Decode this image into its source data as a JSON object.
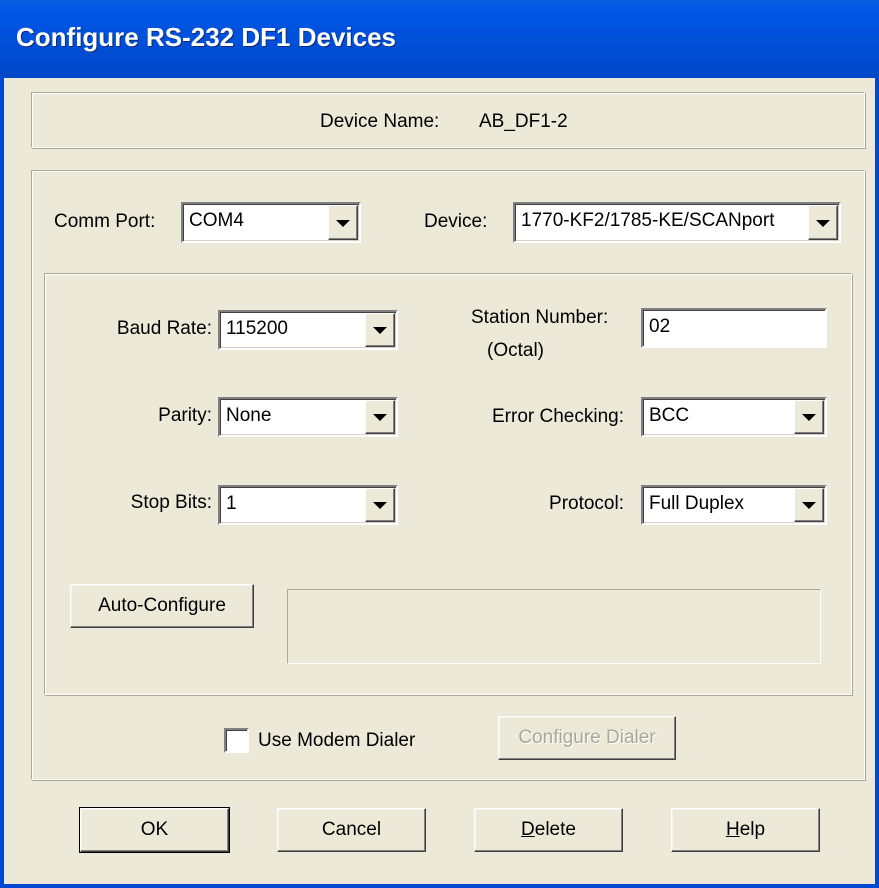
{
  "window": {
    "title": "Configure RS-232 DF1 Devices"
  },
  "device_name": {
    "label": "Device Name:",
    "value": "AB_DF1-2"
  },
  "comm_port": {
    "label": "Comm Port:",
    "value": "COM4"
  },
  "device": {
    "label": "Device:",
    "value": "1770-KF2/1785-KE/SCANport"
  },
  "baud_rate": {
    "label": "Baud Rate:",
    "value": "115200"
  },
  "station_number": {
    "label_line1": "Station Number:",
    "label_line2": "(Octal)",
    "value": "02"
  },
  "parity": {
    "label": "Parity:",
    "value": "None"
  },
  "error_checking": {
    "label": "Error Checking:",
    "value": "BCC"
  },
  "stop_bits": {
    "label": "Stop Bits:",
    "value": "1"
  },
  "protocol": {
    "label": "Protocol:",
    "value": "Full Duplex"
  },
  "auto_configure": {
    "label": "Auto-Configure",
    "status": ""
  },
  "modem": {
    "checkbox_label": "Use Modem Dialer",
    "checked": false,
    "configure_dialer_label": "Configure Dialer"
  },
  "buttons": {
    "ok": "OK",
    "cancel": "Cancel",
    "delete_underlined": "D",
    "delete_rest": "elete",
    "help_underlined": "H",
    "help_rest": "elp"
  }
}
